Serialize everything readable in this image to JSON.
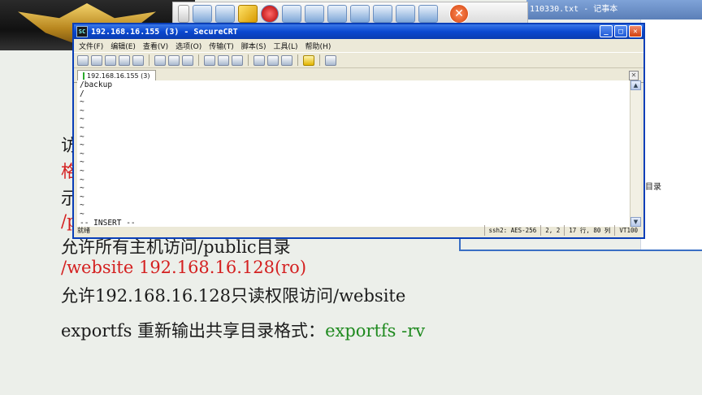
{
  "notepad": {
    "title": "110330.txt - 记事本",
    "visible_text": "目录"
  },
  "toolbar_close_glyph": "✕",
  "slide": {
    "lines": [
      {
        "text": "访",
        "color": "black"
      },
      {
        "text": "格",
        "color": "red"
      },
      {
        "text": "示",
        "color": "black"
      },
      {
        "text": "/p",
        "color": "red"
      },
      {
        "text": "允许所有主机访问/public目录",
        "color": "black"
      },
      {
        "text": "/website 192.168.16.128(ro)",
        "color": "red"
      },
      {
        "text": "允许192.168.16.128只读权限访问/website",
        "color": "black"
      }
    ],
    "export_line": {
      "label": "exportfs  重新输出共享目录格式：",
      "command": "exportfs -rv"
    }
  },
  "crt": {
    "title": "192.168.16.155 (3) - SecureCRT",
    "icon_text": "SC",
    "window_buttons": {
      "minimize": "_",
      "maximize": "□",
      "close": "✕"
    },
    "menu": [
      "文件(F)",
      "编辑(E)",
      "查看(V)",
      "选项(O)",
      "传输(T)",
      "脚本(S)",
      "工具(L)",
      "帮助(H)"
    ],
    "tab": {
      "label": "192.168.16.155 (3)",
      "close": "✕"
    },
    "terminal_lines": [
      "/backup",
      "/",
      "~",
      "~",
      "~",
      "~",
      "~",
      "~",
      "~",
      "~",
      "~",
      "~",
      "~",
      "~",
      "~",
      "~",
      "-- INSERT --"
    ],
    "scroll": {
      "up": "▲",
      "down": "▼"
    },
    "status": {
      "state": "就绪",
      "cells": [
        "ssh2: AES-256",
        "2,  2",
        "17 行, 80 列",
        "VT100"
      ]
    }
  }
}
